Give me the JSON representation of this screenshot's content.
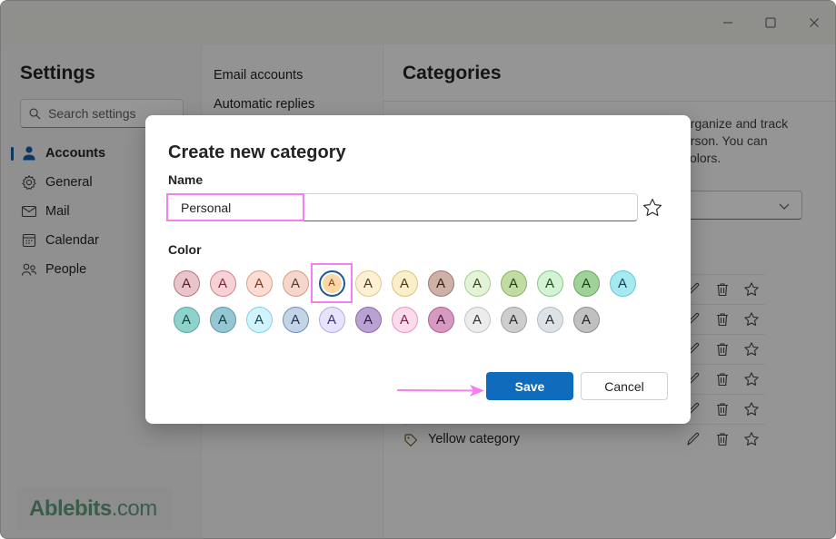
{
  "window": {
    "controls": [
      "minimize",
      "maximize",
      "close"
    ]
  },
  "settings": {
    "title": "Settings",
    "search_placeholder": "Search settings",
    "nav_items": [
      {
        "label": "Accounts",
        "icon": "person-icon",
        "active": true
      },
      {
        "label": "General",
        "icon": "gear-icon",
        "active": false
      },
      {
        "label": "Mail",
        "icon": "mail-icon",
        "active": false
      },
      {
        "label": "Calendar",
        "icon": "calendar-icon",
        "active": false
      },
      {
        "label": "People",
        "icon": "people-icon",
        "active": false
      }
    ],
    "sub_items": [
      "Email accounts",
      "Automatic replies"
    ]
  },
  "categories_pane": {
    "title": "Categories",
    "description_visible": "organize and track\nerson. You can\ncolors.",
    "rows": [
      {
        "name": ""
      },
      {
        "name": ""
      },
      {
        "name": ""
      },
      {
        "name": ""
      },
      {
        "name": ""
      },
      {
        "name": "Yellow category"
      }
    ]
  },
  "dialog": {
    "title": "Create new category",
    "name_label": "Name",
    "name_value": "Personal",
    "color_label": "Color",
    "selected_color_index": 4,
    "colors": [
      {
        "fill": "#e8c5cb",
        "border": "#c0707c",
        "text": "#5a1a22"
      },
      {
        "fill": "#f6d1d5",
        "border": "#d97f8a",
        "text": "#8a1f2b"
      },
      {
        "fill": "#fbddd3",
        "border": "#e59a83",
        "text": "#8a2f1a"
      },
      {
        "fill": "#f4d7ca",
        "border": "#d59c86",
        "text": "#5c3426"
      },
      {
        "fill": "#fcd6a4",
        "border": "#1a5a9c",
        "text": "#6b3d0a"
      },
      {
        "fill": "#fdf0d5",
        "border": "#e6c784",
        "text": "#4a3a14"
      },
      {
        "fill": "#fbefcb",
        "border": "#dfc476",
        "text": "#4a3a14"
      },
      {
        "fill": "#cfb0a6",
        "border": "#9e7b70",
        "text": "#2e1e19"
      },
      {
        "fill": "#e4f2d8",
        "border": "#a6cf8a",
        "text": "#2c4a1b"
      },
      {
        "fill": "#c0dca2",
        "border": "#86b561",
        "text": "#22391a"
      },
      {
        "fill": "#d4f2d4",
        "border": "#85cc85",
        "text": "#1e4a1e"
      },
      {
        "fill": "#9ed29a",
        "border": "#63ab5d",
        "text": "#173d14"
      },
      {
        "fill": "#a6e9f0",
        "border": "#5fcbd8",
        "text": "#12424a"
      },
      {
        "fill": "#8fd2cc",
        "border": "#58a8a1",
        "text": "#10403c"
      },
      {
        "fill": "#95c7d3",
        "border": "#5d9aaa",
        "text": "#103842"
      },
      {
        "fill": "#d0f3fc",
        "border": "#7fd3e6",
        "text": "#15485a"
      },
      {
        "fill": "#c3d4e6",
        "border": "#6e8fb5",
        "text": "#1b2f4d"
      },
      {
        "fill": "#e6e3fb",
        "border": "#b3ace8",
        "text": "#3a2f7a"
      },
      {
        "fill": "#b9a1d2",
        "border": "#8a6bb0",
        "text": "#2a1a45"
      },
      {
        "fill": "#fbdbec",
        "border": "#ec92c2",
        "text": "#7a1a4d"
      },
      {
        "fill": "#d69ac2",
        "border": "#b0648f",
        "text": "#3d1030"
      },
      {
        "fill": "#ececec",
        "border": "#c4c4c4",
        "text": "#333333"
      },
      {
        "fill": "#cdcdcd",
        "border": "#a3a3a3",
        "text": "#2a2a2a"
      },
      {
        "fill": "#dde2e6",
        "border": "#b5bec4",
        "text": "#2a2f33"
      },
      {
        "fill": "#c0c0c0",
        "border": "#8f8f8f",
        "text": "#222222"
      }
    ],
    "swatch_letter": "A",
    "save_label": "Save",
    "cancel_label": "Cancel"
  },
  "watermark": {
    "main": "Ablebits",
    "suffix": ".com"
  },
  "annotations": {
    "highlight_color": "#f57ff0"
  }
}
